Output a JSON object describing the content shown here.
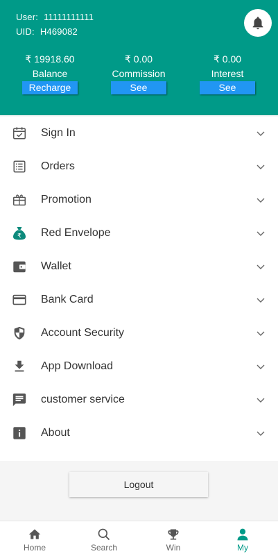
{
  "header": {
    "user_label": "User:",
    "user_value": "11111111111",
    "uid_label": "UID:",
    "uid_value": "H469082",
    "stats": [
      {
        "amount": "₹ 19918.60",
        "label": "Balance",
        "button": "Recharge"
      },
      {
        "amount": "₹ 0.00",
        "label": "Commission",
        "button": "See"
      },
      {
        "amount": "₹ 0.00",
        "label": "Interest",
        "button": "See"
      }
    ],
    "bell_icon": "bell-icon"
  },
  "menu": [
    {
      "label": "Sign In",
      "icon": "calendar-check-icon"
    },
    {
      "label": "Orders",
      "icon": "list-icon"
    },
    {
      "label": "Promotion",
      "icon": "gift-box-icon"
    },
    {
      "label": "Red Envelope",
      "icon": "money-bag-icon"
    },
    {
      "label": "Wallet",
      "icon": "wallet-icon"
    },
    {
      "label": "Bank Card",
      "icon": "credit-card-icon"
    },
    {
      "label": "Account Security",
      "icon": "shield-icon"
    },
    {
      "label": "App Download",
      "icon": "download-icon"
    },
    {
      "label": "customer service",
      "icon": "chat-icon"
    },
    {
      "label": "About",
      "icon": "info-icon"
    }
  ],
  "logout_label": "Logout",
  "tabs": [
    {
      "label": "Home",
      "icon": "home-icon"
    },
    {
      "label": "Search",
      "icon": "search-icon"
    },
    {
      "label": "Win",
      "icon": "trophy-icon"
    },
    {
      "label": "My",
      "icon": "person-icon",
      "active": true
    }
  ],
  "colors": {
    "header": "#009a88",
    "button": "#2196f3",
    "active_tab": "#009a88",
    "icon": "#555555"
  }
}
